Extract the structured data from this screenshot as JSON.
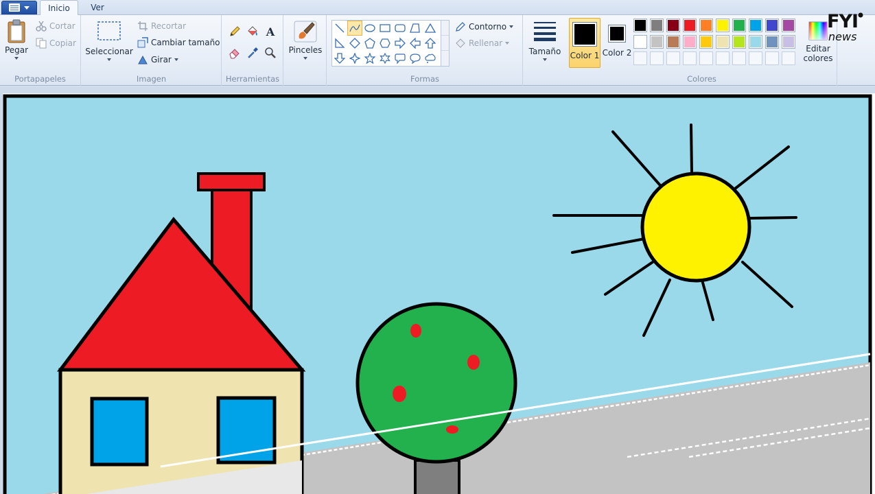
{
  "tabs": [
    {
      "label": "Inicio",
      "active": true
    },
    {
      "label": "Ver",
      "active": false
    }
  ],
  "groups": {
    "portapapeles": {
      "label": "Portapapeles",
      "paste": "Pegar",
      "cut": "Cortar",
      "copy": "Copiar"
    },
    "imagen": {
      "label": "Imagen",
      "select": "Seleccionar",
      "crop": "Recortar",
      "resize": "Cambiar tamaño",
      "rotate": "Girar"
    },
    "herramientas": {
      "label": "Herramientas"
    },
    "pinceles": {
      "label": "Pinceles"
    },
    "formas": {
      "label": "Formas",
      "outline": "Contorno",
      "fill": "Rellenar"
    },
    "tamano": {
      "label": "Tamaño"
    },
    "colores": {
      "label": "Colores",
      "color1": "Color 1",
      "color2": "Color 2",
      "edit": "Editar colores",
      "color1_value": "#000000",
      "color2_value": "#000000",
      "palette_row1": [
        "#000000",
        "#7f7f7f",
        "#880015",
        "#ed1c24",
        "#ff7f27",
        "#fff200",
        "#22b14c",
        "#00a2e8",
        "#3f48cc",
        "#a349a4"
      ],
      "palette_row2": [
        "#ffffff",
        "#c3c3c3",
        "#b97a57",
        "#ffaec9",
        "#ffc90e",
        "#efe4b0",
        "#b5e61d",
        "#99d9ea",
        "#7092be",
        "#c8bfe7"
      ]
    }
  },
  "tool_icons": [
    "pencil-icon",
    "fill-bucket-icon",
    "text-icon",
    "eraser-icon",
    "color-picker-icon",
    "magnifier-icon"
  ],
  "shape_icons": [
    "line-icon",
    "curve-icon",
    "oval-icon",
    "rectangle-icon",
    "rounded-rectangle-icon",
    "polygon-icon",
    "triangle-icon",
    "right-triangle-icon",
    "diamond-icon",
    "pentagon-icon",
    "hexagon-icon",
    "right-arrow-icon",
    "left-arrow-icon",
    "up-arrow-icon",
    "down-arrow-icon",
    "four-point-star-icon",
    "five-point-star-icon",
    "six-point-star-icon",
    "rounded-callout-icon",
    "oval-callout-icon",
    "cloud-callout-icon"
  ],
  "logo": {
    "text": "FYI",
    "subtext": "news"
  },
  "drawing_colors": {
    "sky": "#99d9ea",
    "ground": "#c3c3c3",
    "roof": "#ed1c24",
    "wall": "#efe4b0",
    "window": "#00a2e8",
    "tree": "#22b14c",
    "sun": "#fff200",
    "trunk": "#7f7f7f"
  }
}
